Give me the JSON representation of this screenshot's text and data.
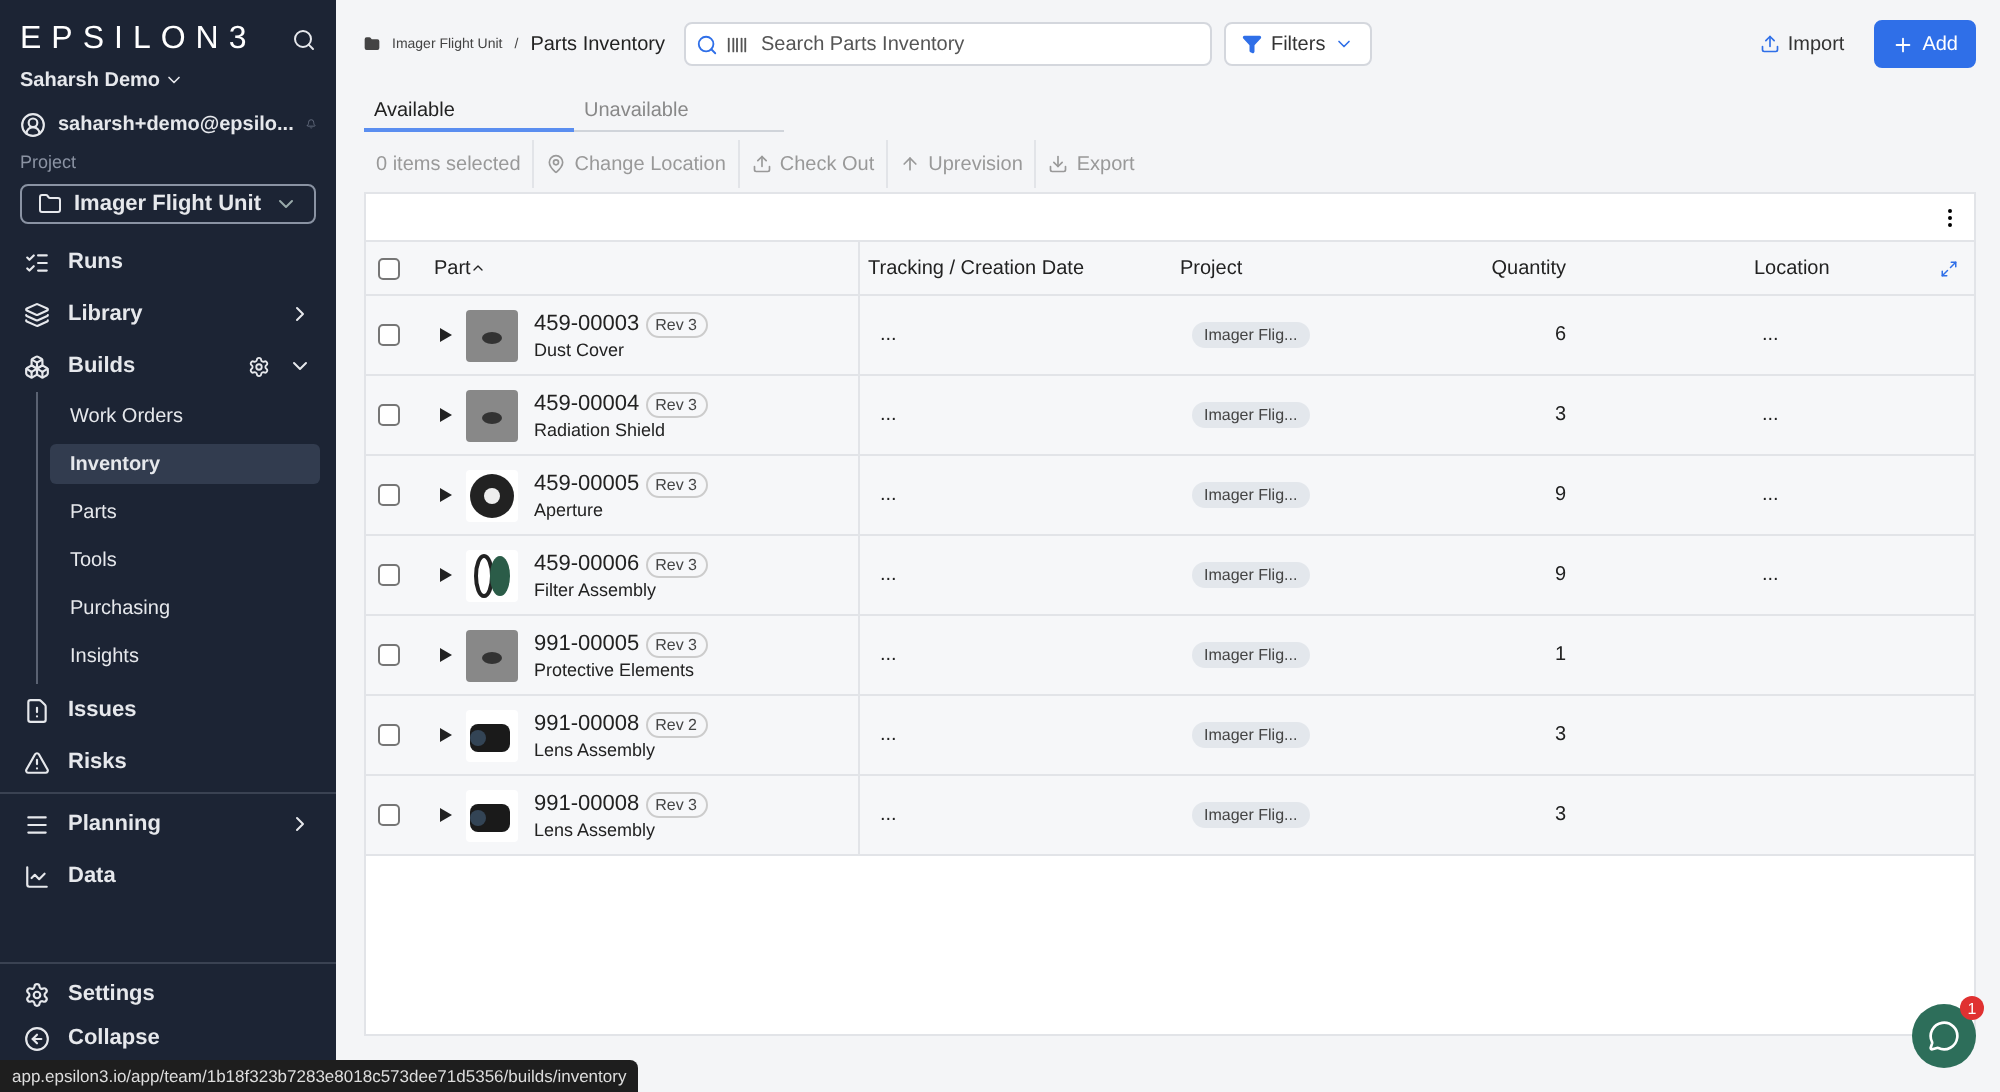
{
  "sidebar": {
    "logo": "EPSILON3",
    "team": "Saharsh Demo",
    "user_email": "saharsh+demo@epsilo...",
    "project_label": "Project",
    "project": "Imager Flight Unit",
    "nav": [
      {
        "kind": "runs",
        "label": "Runs"
      },
      {
        "kind": "library",
        "label": "Library",
        "expanded": false
      },
      {
        "kind": "builds",
        "label": "Builds",
        "expanded": true,
        "children": [
          {
            "label": "Work Orders",
            "selected": false
          },
          {
            "label": "Inventory",
            "selected": true
          },
          {
            "label": "Parts",
            "selected": false
          },
          {
            "label": "Tools",
            "selected": false
          },
          {
            "label": "Purchasing",
            "selected": false
          },
          {
            "label": "Insights",
            "selected": false
          }
        ]
      },
      {
        "kind": "issues",
        "label": "Issues"
      },
      {
        "kind": "risks",
        "label": "Risks",
        "divider_after": true
      },
      {
        "kind": "planning",
        "label": "Planning",
        "expanded": false
      },
      {
        "kind": "data",
        "label": "Data"
      }
    ],
    "bottom": [
      {
        "kind": "settings",
        "label": "Settings"
      },
      {
        "kind": "collapse",
        "label": "Collapse"
      }
    ]
  },
  "breadcrumb": {
    "parent": "Imager Flight Unit",
    "separator": "/",
    "current": "Parts Inventory"
  },
  "search": {
    "placeholder": "Search Parts Inventory"
  },
  "filters_button": "Filters",
  "import_button": "Import",
  "add_button": "Add",
  "tabs": [
    {
      "label": "Available",
      "selected": true
    },
    {
      "label": "Unavailable",
      "selected": false
    }
  ],
  "toolbar": {
    "selection": "0 items selected",
    "actions": [
      {
        "kind": "location",
        "label": "Change Location",
        "disabled": true
      },
      {
        "kind": "checkout",
        "label": "Check Out",
        "disabled": true
      },
      {
        "kind": "uprev",
        "label": "Uprevision",
        "disabled": true
      },
      {
        "kind": "export",
        "label": "Export",
        "disabled": true
      }
    ]
  },
  "table": {
    "all_checked": false,
    "columns": [
      "Part",
      "Tracking / Creation Date",
      "Project",
      "Quantity",
      "Location"
    ],
    "rows": [
      {
        "part_number": "459-00003",
        "rev": "Rev 3",
        "name": "Dust Cover",
        "tracking": "...",
        "project": "Imager Flig...",
        "quantity": "6",
        "location": "...",
        "checked": false,
        "expanded": false
      },
      {
        "part_number": "459-00004",
        "rev": "Rev 3",
        "name": "Radiation Shield",
        "tracking": "...",
        "project": "Imager Flig...",
        "quantity": "3",
        "location": "...",
        "checked": false,
        "expanded": false
      },
      {
        "part_number": "459-00005",
        "rev": "Rev 3",
        "name": "Aperture",
        "tracking": "...",
        "project": "Imager Flig...",
        "quantity": "9",
        "location": "...",
        "checked": false,
        "expanded": false
      },
      {
        "part_number": "459-00006",
        "rev": "Rev 3",
        "name": "Filter Assembly",
        "tracking": "...",
        "project": "Imager Flig...",
        "quantity": "9",
        "location": "...",
        "checked": false,
        "expanded": false
      },
      {
        "part_number": "991-00005",
        "rev": "Rev 3",
        "name": "Protective Elements",
        "tracking": "...",
        "project": "Imager Flig...",
        "quantity": "1",
        "checked": false,
        "expanded": false
      },
      {
        "part_number": "991-00008",
        "rev": "Rev 2",
        "name": "Lens Assembly",
        "tracking": "...",
        "project": "Imager Flig...",
        "quantity": "3",
        "checked": false,
        "expanded": false
      },
      {
        "part_number": "991-00008",
        "rev": "Rev 3",
        "name": "Lens Assembly",
        "tracking": "...",
        "project": "Imager Flig...",
        "quantity": "3",
        "checked": false,
        "expanded": false
      }
    ]
  },
  "status_url": "app.epsilon3.io/app/team/1b18f323b7283e8018c573dee71d5356/builds/inventory",
  "chat_badge": "1"
}
